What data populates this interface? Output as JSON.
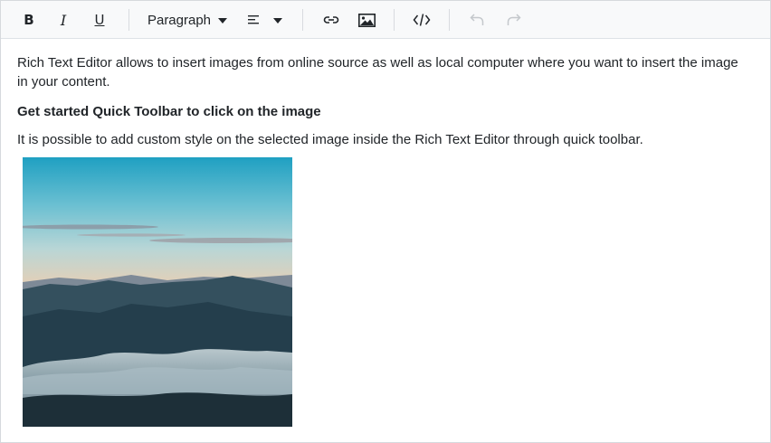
{
  "toolbar": {
    "bold_label": "B",
    "italic_label": "I",
    "underline_label": "U",
    "format_label": "Paragraph",
    "icons": [
      "bold-icon",
      "italic-icon",
      "underline-icon",
      "chevron-down-icon",
      "align-left-icon",
      "chevron-down-icon",
      "link-icon",
      "image-icon",
      "source-code-icon",
      "undo-icon",
      "redo-icon"
    ]
  },
  "content": {
    "paragraph1": "Rich Text Editor allows to insert images from online source as well as local computer where you want to insert the image in your content.",
    "heading": "Get started Quick Toolbar to click on the image",
    "paragraph2": "It is possible to add custom style on the selected image inside the Rich Text Editor through quick toolbar."
  }
}
